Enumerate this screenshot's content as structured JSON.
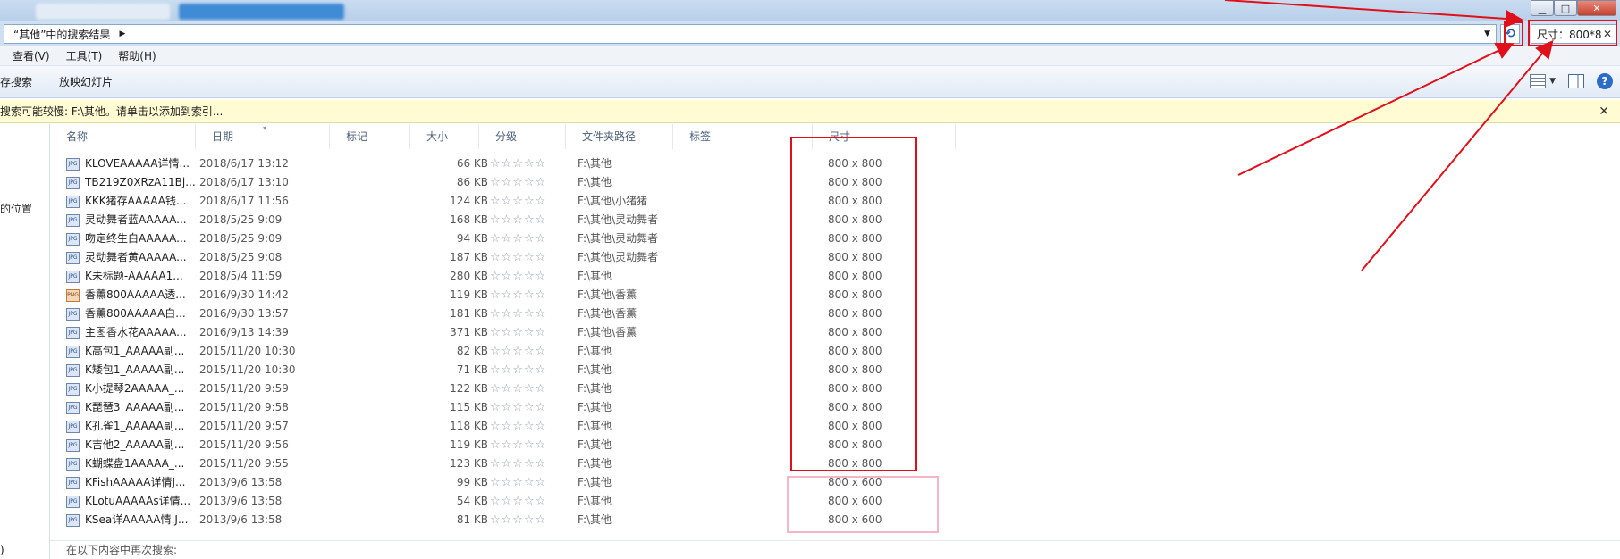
{
  "window": {
    "address_crumb": "“其他”中的搜索结果",
    "search_value": "尺寸：800*8"
  },
  "menu": [
    "查看(V)",
    "工具(T)",
    "帮助(H)"
  ],
  "toolbar": {
    "save_search": "存搜索",
    "slideshow": "放映幻灯片"
  },
  "infobar": {
    "text": "搜索可能较慢: F:\\其他。请单击以添加到索引..."
  },
  "navpane": {
    "location": "的位置",
    "bottom": ")"
  },
  "columns": [
    "名称",
    "日期",
    "标记",
    "大小",
    "分级",
    "文件夹路径",
    "标签",
    "尺寸"
  ],
  "rows": [
    {
      "type": "JPG",
      "name": "KLOVEAAAAA详情...",
      "date": "2018/6/17 13:12",
      "size": "66 KB",
      "folder": "F:\\其他",
      "dim": "800 x 800"
    },
    {
      "type": "JPG",
      "name": "TB219Z0XRzA11Bj...",
      "date": "2018/6/17 13:10",
      "size": "86 KB",
      "folder": "F:\\其他",
      "dim": "800 x 800"
    },
    {
      "type": "JPG",
      "name": "KKK猪存AAAAA钱...",
      "date": "2018/6/17 11:56",
      "size": "124 KB",
      "folder": "F:\\其他\\小猪猪",
      "dim": "800 x 800"
    },
    {
      "type": "JPG",
      "name": "灵动舞者蓝AAAAA...",
      "date": "2018/5/25 9:09",
      "size": "168 KB",
      "folder": "F:\\其他\\灵动舞者",
      "dim": "800 x 800"
    },
    {
      "type": "JPG",
      "name": "吻定终生白AAAAA...",
      "date": "2018/5/25 9:09",
      "size": "94 KB",
      "folder": "F:\\其他\\灵动舞者",
      "dim": "800 x 800"
    },
    {
      "type": "JPG",
      "name": "灵动舞者黄AAAAA...",
      "date": "2018/5/25 9:08",
      "size": "187 KB",
      "folder": "F:\\其他\\灵动舞者",
      "dim": "800 x 800"
    },
    {
      "type": "JPG",
      "name": "K未标题-AAAAA1...",
      "date": "2018/5/4 11:59",
      "size": "280 KB",
      "folder": "F:\\其他",
      "dim": "800 x 800"
    },
    {
      "type": "PNG",
      "name": "香薰800AAAAA透...",
      "date": "2016/9/30 14:42",
      "size": "119 KB",
      "folder": "F:\\其他\\香薰",
      "dim": "800 x 800"
    },
    {
      "type": "JPG",
      "name": "香薰800AAAAA白...",
      "date": "2016/9/30 13:57",
      "size": "181 KB",
      "folder": "F:\\其他\\香薰",
      "dim": "800 x 800"
    },
    {
      "type": "JPG",
      "name": "主图香水花AAAAA...",
      "date": "2016/9/13 14:39",
      "size": "371 KB",
      "folder": "F:\\其他\\香薰",
      "dim": "800 x 800"
    },
    {
      "type": "JPG",
      "name": "K高包1_AAAAA副...",
      "date": "2015/11/20 10:30",
      "size": "82 KB",
      "folder": "F:\\其他",
      "dim": "800 x 800"
    },
    {
      "type": "JPG",
      "name": "K矮包1_AAAAA副...",
      "date": "2015/11/20 10:30",
      "size": "71 KB",
      "folder": "F:\\其他",
      "dim": "800 x 800"
    },
    {
      "type": "JPG",
      "name": "K小提琴2AAAAA_...",
      "date": "2015/11/20 9:59",
      "size": "122 KB",
      "folder": "F:\\其他",
      "dim": "800 x 800"
    },
    {
      "type": "JPG",
      "name": "K琵琶3_AAAAA副...",
      "date": "2015/11/20 9:58",
      "size": "115 KB",
      "folder": "F:\\其他",
      "dim": "800 x 800"
    },
    {
      "type": "JPG",
      "name": "K孔雀1_AAAAA副...",
      "date": "2015/11/20 9:57",
      "size": "118 KB",
      "folder": "F:\\其他",
      "dim": "800 x 800"
    },
    {
      "type": "JPG",
      "name": "K吉他2_AAAAA副...",
      "date": "2015/11/20 9:56",
      "size": "119 KB",
      "folder": "F:\\其他",
      "dim": "800 x 800"
    },
    {
      "type": "JPG",
      "name": "K蝴蝶盘1AAAAA_...",
      "date": "2015/11/20 9:55",
      "size": "123 KB",
      "folder": "F:\\其他",
      "dim": "800 x 800"
    },
    {
      "type": "JPG",
      "name": "KFishAAAAA详情J...",
      "date": "2013/9/6 13:58",
      "size": "99 KB",
      "folder": "F:\\其他",
      "dim": "800 x 600"
    },
    {
      "type": "JPG",
      "name": "KLotuAAAAAs详情...",
      "date": "2013/9/6 13:58",
      "size": "54 KB",
      "folder": "F:\\其他",
      "dim": "800 x 600"
    },
    {
      "type": "JPG",
      "name": "KSea详AAAAA情.J...",
      "date": "2013/9/6 13:58",
      "size": "81 KB",
      "folder": "F:\\其他",
      "dim": "800 x 600"
    }
  ],
  "stars": "☆☆☆☆☆",
  "bottom_text": "在以下内容中再次搜索:",
  "colors": {
    "annotation_red": "#e0101a",
    "annotation_pink": "#f2b6c6",
    "infobar_bg": "#fffbd2"
  }
}
